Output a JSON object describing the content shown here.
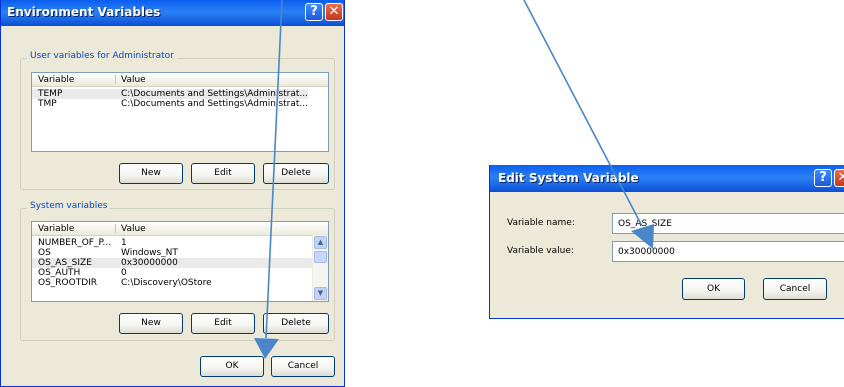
{
  "env_dialog": {
    "title": "Environment Variables",
    "help_glyph": "?",
    "close_glyph": "✕",
    "user_group": {
      "label": "User variables for Administrator",
      "columns": [
        "Variable",
        "Value"
      ],
      "rows": [
        {
          "variable": "TEMP",
          "value": "C:\\Documents and Settings\\Administrat..."
        },
        {
          "variable": "TMP",
          "value": "C:\\Documents and Settings\\Administrat..."
        }
      ],
      "buttons": {
        "new": "New",
        "edit": "Edit",
        "delete": "Delete"
      }
    },
    "system_group": {
      "label": "System variables",
      "columns": [
        "Variable",
        "Value"
      ],
      "rows": [
        {
          "variable": "NUMBER_OF_P...",
          "value": "1"
        },
        {
          "variable": "OS",
          "value": "Windows_NT"
        },
        {
          "variable": "OS_AS_SIZE",
          "value": "0x30000000"
        },
        {
          "variable": "OS_AUTH",
          "value": "0"
        },
        {
          "variable": "OS_ROOTDIR",
          "value": "C:\\Discovery\\OStore"
        }
      ],
      "buttons": {
        "new": "New",
        "edit": "Edit",
        "delete": "Delete"
      }
    },
    "ok_label": "OK",
    "cancel_label": "Cancel"
  },
  "edit_dialog": {
    "title": "Edit System Variable",
    "help_glyph": "?",
    "close_glyph": "✕",
    "name_label": "Variable name:",
    "name_value": "OS_AS_SIZE",
    "value_label": "Variable value:",
    "value_value": "0x30000000",
    "ok_label": "OK",
    "cancel_label": "Cancel"
  },
  "icons": {
    "scroll_up": "chevron-up-icon",
    "scroll_down": "chevron-down-icon",
    "annotation": "arrow-icon"
  },
  "colors": {
    "titlebar": "#0a5ef0",
    "dialog_face": "#ece9d8",
    "group_label": "#0046d5",
    "arrow": "#4a86c8"
  }
}
